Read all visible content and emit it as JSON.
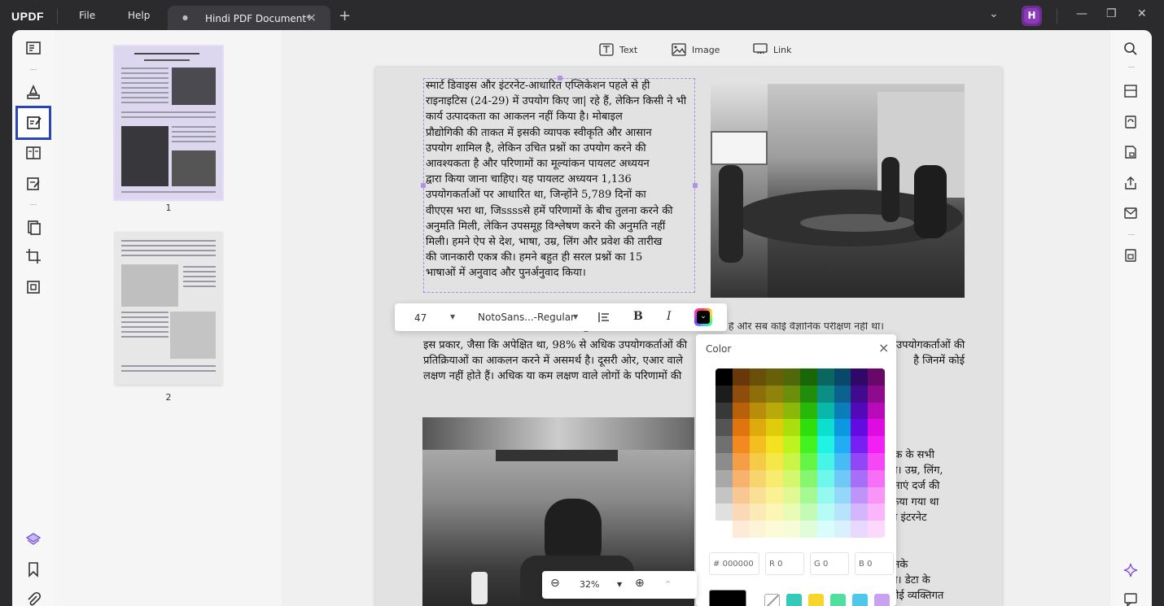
{
  "app": {
    "logo": "UPDF",
    "menu_file": "File",
    "menu_help": "Help",
    "avatar_initial": "H"
  },
  "tab": {
    "title": "Hindi PDF Document*",
    "close": "×",
    "new": "+"
  },
  "window_controls": {
    "dropdown": "⌄",
    "minimize": "—",
    "restore": "❐",
    "close": "✕"
  },
  "toolbar": {
    "text_label": "Text",
    "image_label": "Image",
    "link_label": "Link"
  },
  "thumbnails": [
    {
      "page": "1"
    },
    {
      "page": "2"
    }
  ],
  "document": {
    "block1": [
      "स्मार्ट डिवाइस और इंटरनेट-आधारित एप्लिकेशन पहले से ही",
      "राइनाइटिस (24-29) में उपयोग किए जा| रहे हैं, लेकिन किसी ने भी",
      "कार्य उत्पादकता का आकलन नहीं किया है। मोबाइल",
      "प्रौद्योगिकी की ताकत में इसकी व्यापक स्वीकृति और आसान",
      "उपयोग शामिल है, लेकिन उचित प्रश्नों का उपयोग करने की",
      "आवश्यकता है और परिणामों का मूल्यांकन पायलट अध्ययन",
      "द्वारा किया जाना चाहिए। यह पायलट अध्ययन 1,136",
      "उपयोगकर्ताओं पर आधारित था, जिन्होंने 5,789 दिनों का",
      "वीएएस भरा था, जिssssसे हमें परिणामों के बीच तुलना करने की",
      "अनुमति मिली, लेकिन उपसमूह विश्लेषण करने की अनुमति नहीं",
      "मिली। हमने ऐप से देश, भाषा, उम्र, लिंग और प्रवेश की तारीख",
      "की जानकारी एकत्र की। हमने बहुत ही सरल प्रश्नों का 15",
      "भाषाओं में अनुवाद और पुनर्अनुवाद किया।"
    ],
    "block2_top": "एप का एआर रोगियों का नियंत्रण विषयों से तुलना करने के लिए डिज़ाइन किया गया है और सब कोई वैज्ञानिक परीक्षण नहीं था।",
    "block2": [
      "इस प्रकार, जैसा कि अपेक्षित था, 98% से अधिक उपयोगकर्ताओं की",
      "प्रतिक्रियाओं का आकलन करने में असमर्थ है। दूसरी ओर, एआर वाले",
      "लक्षण नहीं होते हैं। अधिक या कम लक्षण वाले लोगों के परिणामों की"
    ],
    "block2_right": [
      "उपयोगकर्ताओं की",
      "है जिनमें कोई"
    ],
    "block3_right": [
      "तक के सभी",
      "था। उम्र, लिंग,",
      "तनाएं दर्ज की",
      "किया गया था",
      "न्य इंटरनेट"
    ],
    "block4_right": [
      "उनके",
      "था। डेटा के",
      "कोई व्यक्तिगत"
    ]
  },
  "format_bar": {
    "font_size": "47",
    "font_name": "NotoSans...-Regular",
    "bold": "B",
    "italic": "I"
  },
  "color_panel": {
    "title": "Color",
    "close": "×",
    "hex_label": "#",
    "hex_value": "000000",
    "r_label": "R",
    "r_value": "0",
    "g_label": "G",
    "g_value": "0",
    "b_label": "B",
    "b_value": "0",
    "recent_colors": [
      "#34c9b8",
      "#f8d52a",
      "#4fe0a0",
      "#4fc7ea",
      "#c9a2ef"
    ],
    "current_color": "#000000"
  },
  "zoom": {
    "value": "32%"
  }
}
